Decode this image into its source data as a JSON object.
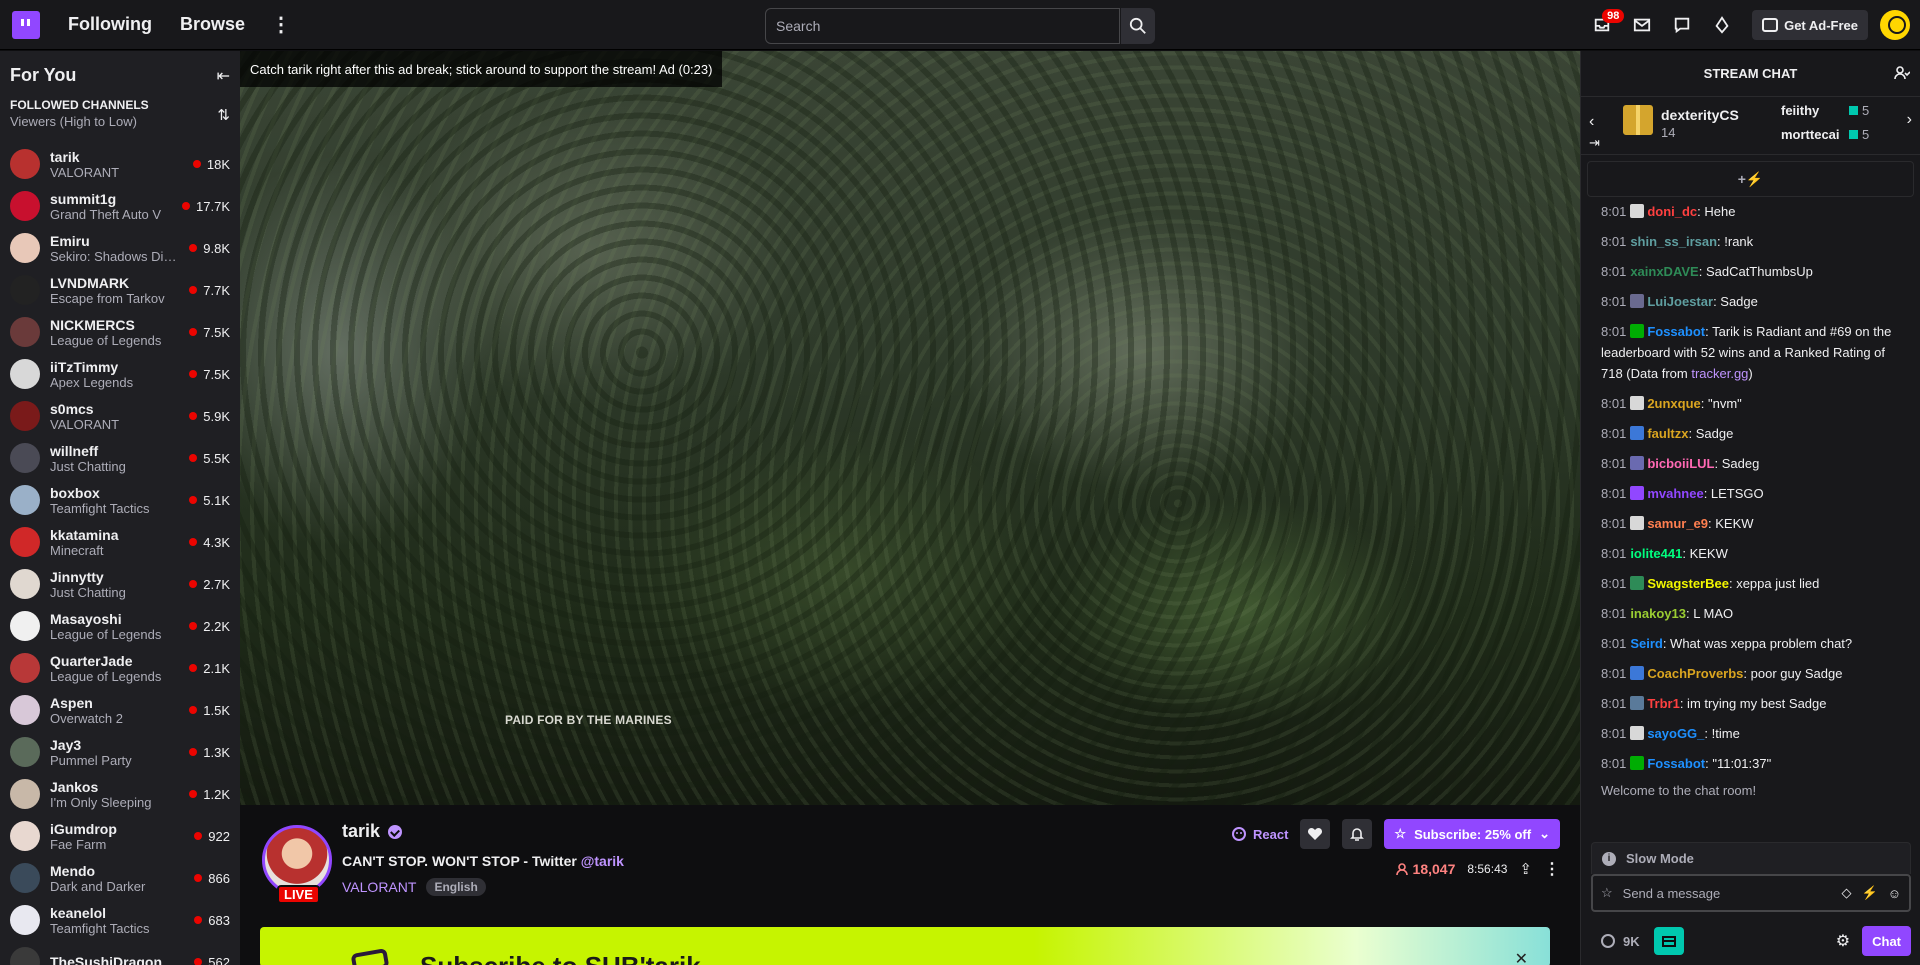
{
  "nav": {
    "following": "Following",
    "browse": "Browse",
    "search_placeholder": "Search",
    "notifications_count": "98",
    "get_ad_free": "Get Ad-Free"
  },
  "sidebar": {
    "title": "For You",
    "section_title": "FOLLOWED CHANNELS",
    "sort_label": "Viewers (High to Low)",
    "channels": [
      {
        "name": "tarik",
        "game": "VALORANT",
        "viewers": "18K",
        "color": "#b8312f"
      },
      {
        "name": "summit1g",
        "game": "Grand Theft Auto V",
        "viewers": "17.7K",
        "color": "#c8102e"
      },
      {
        "name": "Emiru",
        "game": "Sekiro: Shadows Die Twice",
        "viewers": "9.8K",
        "color": "#e8c8b8"
      },
      {
        "name": "LVNDMARK",
        "game": "Escape from Tarkov",
        "viewers": "7.7K",
        "color": "#222222"
      },
      {
        "name": "NICKMERCS",
        "game": "League of Legends",
        "viewers": "7.5K",
        "color": "#6a3a3a"
      },
      {
        "name": "iiTzTimmy",
        "game": "Apex Legends",
        "viewers": "7.5K",
        "color": "#d8d8d8"
      },
      {
        "name": "s0mcs",
        "game": "VALORANT",
        "viewers": "5.9K",
        "color": "#7a1a1a"
      },
      {
        "name": "willneff",
        "game": "Just Chatting",
        "viewers": "5.5K",
        "color": "#4a4a55"
      },
      {
        "name": "boxbox",
        "game": "Teamfight Tactics",
        "viewers": "5.1K",
        "color": "#9ab0c8"
      },
      {
        "name": "kkatamina",
        "game": "Minecraft",
        "viewers": "4.3K",
        "color": "#d02828"
      },
      {
        "name": "Jinnytty",
        "game": "Just Chatting",
        "viewers": "2.7K",
        "color": "#e0d8d0"
      },
      {
        "name": "Masayoshi",
        "game": "League of Legends",
        "viewers": "2.2K",
        "color": "#f0f0f0"
      },
      {
        "name": "QuarterJade",
        "game": "League of Legends",
        "viewers": "2.1K",
        "color": "#b83838"
      },
      {
        "name": "Aspen",
        "game": "Overwatch 2",
        "viewers": "1.5K",
        "color": "#d8c8d8"
      },
      {
        "name": "Jay3",
        "game": "Pummel Party",
        "viewers": "1.3K",
        "color": "#5a6a5a"
      },
      {
        "name": "Jankos",
        "game": "I'm Only Sleeping",
        "viewers": "1.2K",
        "color": "#c8b8a8"
      },
      {
        "name": "iGumdrop",
        "game": "Fae Farm",
        "viewers": "922",
        "color": "#e8d8d0"
      },
      {
        "name": "Mendo",
        "game": "Dark and Darker",
        "viewers": "866",
        "color": "#3a4a5a"
      },
      {
        "name": "keanelol",
        "game": "Teamfight Tactics",
        "viewers": "683",
        "color": "#e8e8f0"
      },
      {
        "name": "TheSushiDragon",
        "game": "",
        "viewers": "562",
        "color": "#3a3a3a"
      }
    ]
  },
  "player": {
    "ad_text": "Catch tarik right after this ad break; stick around to support the stream! Ad (0:23)",
    "paid_by": "PAID FOR BY THE MARINES"
  },
  "channel": {
    "name": "tarik",
    "live": "LIVE",
    "title": "CAN'T STOP. WON'T STOP - Twitter ",
    "handle": "@tarik",
    "game": "VALORANT",
    "tag": "English",
    "react": "React",
    "subscribe": "Subscribe: 25% off",
    "viewers": "18,047",
    "uptime": "8:56:43",
    "promo_text": "Subscribe to SUB'tarik"
  },
  "chat": {
    "header": "STREAM CHAT",
    "leaderboard": {
      "top_user": "dexterityCS",
      "top_count": "14",
      "user2": "feiithy",
      "count2": "5",
      "user3": "morttecai",
      "count3": "5"
    },
    "messages": [
      {
        "time": "8:01",
        "user": "doni_dc",
        "color": "#ff4040",
        "text": ": Hehe",
        "badge": "#d8d8d8"
      },
      {
        "time": "8:01",
        "user": "shin_ss_irsan",
        "color": "#5f9ea0",
        "text": ": !rank",
        "badge": ""
      },
      {
        "time": "8:01",
        "user": "xainxDAVE",
        "color": "#2e8b57",
        "text": ": SadCatThumbsUp",
        "badge": ""
      },
      {
        "time": "8:01",
        "user": "LuiJoestar",
        "color": "#5f9ea0",
        "text": ": Sadge",
        "badge": "#6a6a90"
      },
      {
        "time": "8:01",
        "user": "Fossabot",
        "color": "#1e90ff",
        "text": ": Tarik is Radiant and #69 on the leaderboard with 52 wins and a Ranked Rating of 718 (Data from ",
        "link": "tracker.gg",
        "after": ")",
        "badge": "#00ad03"
      },
      {
        "time": "8:01",
        "user": "2unxque",
        "color": "#daa520",
        "text": ": \"nvm\"",
        "badge": "#d8d8d8"
      },
      {
        "time": "8:01",
        "user": "faultzx",
        "color": "#daa520",
        "text": ": Sadge",
        "badge": "#3c78d8"
      },
      {
        "time": "8:01",
        "user": "bicboiiLUL",
        "color": "#ff69b4",
        "text": ": Sadeg",
        "badge": "#6a6ab0"
      },
      {
        "time": "8:01",
        "user": "mvahnee",
        "color": "#9147ff",
        "text": ": LETSGO",
        "badge": "#9147ff"
      },
      {
        "time": "8:01",
        "user": "samur_e9",
        "color": "#ff7f50",
        "text": ": KEKW",
        "badge": "#d8d8d8"
      },
      {
        "time": "8:01",
        "user": "iolite441",
        "color": "#00ff7f",
        "text": ": KEKW",
        "badge": ""
      },
      {
        "time": "8:01",
        "user": "SwagsterBee",
        "color": "#f2f600",
        "text": ": xeppa just lied",
        "badge": "#2e8b57"
      },
      {
        "time": "8:01",
        "user": "inakoy13",
        "color": "#9acd32",
        "text": ": L MAO",
        "badge": ""
      },
      {
        "time": "8:01",
        "user": "Seird",
        "color": "#1e90ff",
        "text": ": What was xeppa problem chat?",
        "badge": ""
      },
      {
        "time": "8:01",
        "user": "CoachProverbs",
        "color": "#daa520",
        "text": ": poor guy Sadge",
        "badge": "#3c78d8"
      },
      {
        "time": "8:01",
        "user": "Trbr1",
        "color": "#ff4040",
        "text": ": im trying my best Sadge",
        "badge": "#5a7a9a"
      },
      {
        "time": "8:01",
        "user": "sayoGG_",
        "color": "#1e90ff",
        "text": ": !time",
        "badge": "#d8d8d8"
      },
      {
        "time": "8:01",
        "user": "Fossabot",
        "color": "#1e90ff",
        "text": ": \"11:01:37\"",
        "badge": "#00ad03"
      }
    ],
    "welcome": "Welcome to the chat room!",
    "slow_mode": "Slow Mode",
    "input_placeholder": "Send a message",
    "points": "9K",
    "chat_button": "Chat"
  }
}
